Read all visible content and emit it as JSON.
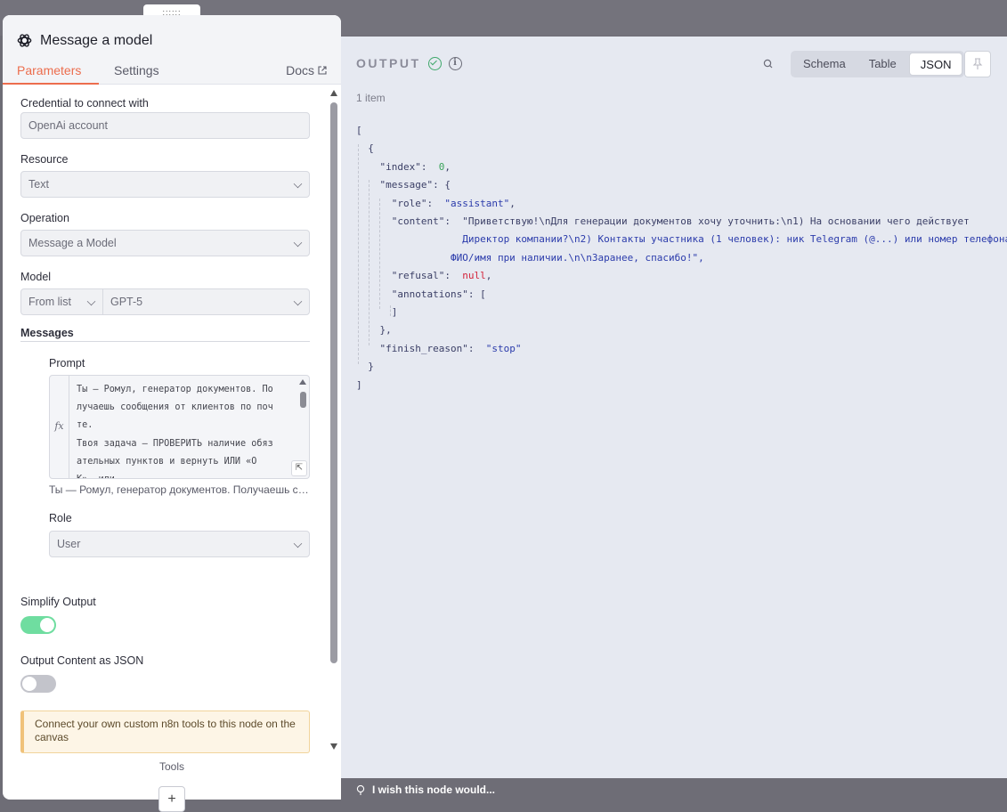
{
  "output": {
    "title": "OUTPUT",
    "items_count": "1 item",
    "view_tabs": [
      "Schema",
      "Table",
      "JSON"
    ],
    "active_view": "JSON"
  },
  "json_lines": [
    "[",
    "  {",
    "    \"index\":  0,",
    "    \"message\": {",
    "      \"role\":  \"assistant\",",
    "      \"content\":  \"Приветствую!\\nДля генерации документов хочу уточнить:\\n1) На основании чего действует",
    "                  Директор компании?\\n2) Контакты участника (1 человек): ник Telegram (@...) или номер телефона;",
    "                ФИО/имя при наличии.\\n\\nЗаранее, спасибо!\",",
    "      \"refusal\":  null,",
    "      \"annotations\": [",
    "      ]",
    "    },",
    "    \"finish_reason\":  \"stop\"",
    "  }",
    "]"
  ],
  "wish": "I wish this node would...",
  "panel": {
    "drag_handle": "::::::",
    "title": "Message a model",
    "tabs": {
      "parameters": "Parameters",
      "settings": "Settings",
      "docs": "Docs"
    },
    "credential_label": "Credential to connect with",
    "credential_value": "OpenAi account",
    "resource_label": "Resource",
    "resource_value": "Text",
    "operation_label": "Operation",
    "operation_value": "Message a Model",
    "model_label": "Model",
    "model_mode": "From list",
    "model_value": "GPT-5",
    "messages_label": "Messages",
    "prompt_label": "Prompt",
    "prompt_lines": [
      "Ты — Ромул, генератор документов. По",
      "лучаешь сообщения от клиентов по поч",
      "те.",
      "Твоя задача — ПРОВЕРИТЬ наличие обяз",
      "ательных пунктов и вернуть ИЛИ «О",
      "К», или"
    ],
    "prompt_preview": "Ты — Ромул, генератор документов. Получаешь сообщения от клиентов по почте.",
    "role_label": "Role",
    "role_value": "User",
    "simplify_label": "Simplify Output",
    "simplify_on": true,
    "json_label": "Output Content as JSON",
    "json_on": false,
    "callout": "Connect your own custom n8n tools to this node on the canvas",
    "tools_label": "Tools",
    "add_label": "+"
  },
  "colors": {
    "accent": "#ec6d4d",
    "toggle_on": "#6fdda0",
    "toggle_off": "#c3c4cb",
    "success": "#3fa86b"
  }
}
